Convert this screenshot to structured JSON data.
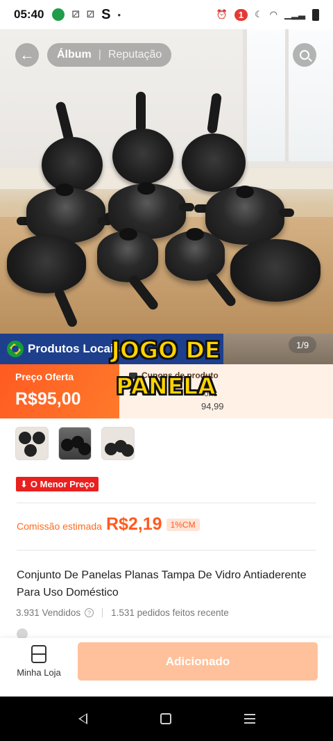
{
  "status_bar": {
    "time": "05:40",
    "notification_count": "1"
  },
  "gallery": {
    "tab_album": "Álbum",
    "tab_reputation": "Reputação",
    "page_indicator": "1/9"
  },
  "banner": {
    "local_products": "Produtos Locais"
  },
  "overlay": {
    "title": "JOGO DE PANELA"
  },
  "price": {
    "offer_label": "Preço Oferta",
    "offer_value": "R$95,00",
    "coupons_label": "Cupons de produto",
    "coupon_note": "ons",
    "old_price": "94,99"
  },
  "badges": {
    "lowest_price": "O Menor Preço"
  },
  "commission": {
    "label": "Comissão estimada",
    "value": "R$2,19",
    "rate": "1%CM"
  },
  "product": {
    "title": "Conjunto De Panelas Planas Tampa De Vidro Antiaderente Para Uso Doméstico",
    "sold": "3.931 Vendidos",
    "recent_orders": "1.531 pedidos feitos recente"
  },
  "bottom_bar": {
    "store_label": "Minha Loja",
    "add_button": "Adicionado"
  },
  "colors": {
    "accent": "#ff5a22",
    "banner_blue": "#1d3f8c",
    "badge_red": "#e8201f",
    "button_disabled": "#ffc19b"
  }
}
